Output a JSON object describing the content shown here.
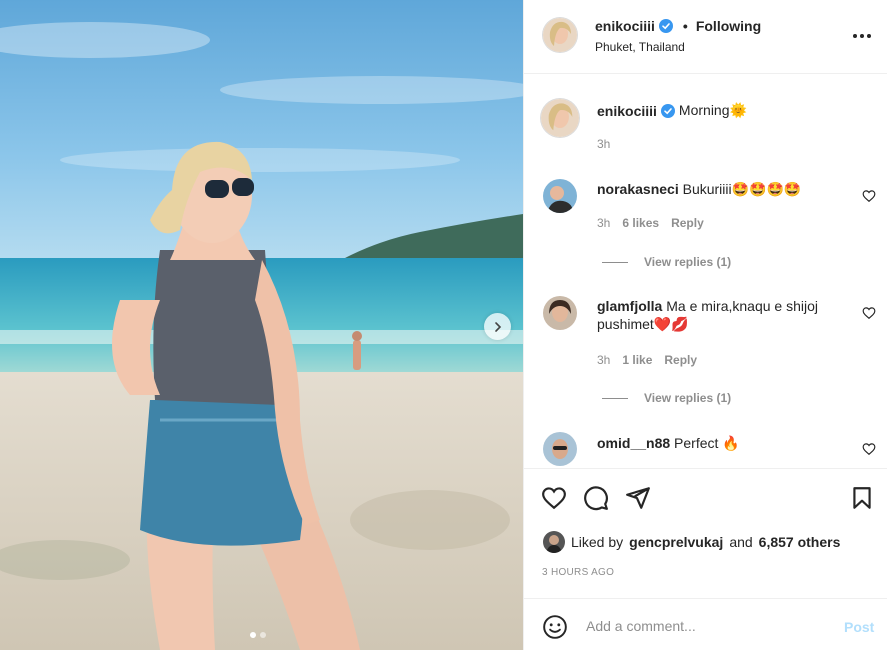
{
  "post": {
    "username": "enikociiii",
    "following_label": "Following",
    "location": "Phuket, Thailand",
    "caption": "Morning🌞",
    "caption_time": "3h"
  },
  "photo": {
    "slide_count": 2,
    "active_slide": 1,
    "next_icon": "chevron-right-icon"
  },
  "comments": [
    {
      "username": "norakasneci",
      "text": "Bukuriiii🤩🤩🤩🤩",
      "time": "3h",
      "likes": "6 likes",
      "reply_label": "Reply",
      "view_replies": "View replies (1)"
    },
    {
      "username": "glamfjolla",
      "text": "Ma e mira,knaqu e shijoj pushimet❤️💋",
      "time": "3h",
      "likes": "1 like",
      "reply_label": "Reply",
      "view_replies": "View replies (1)"
    },
    {
      "username": "omid__n88",
      "text": "Perfect 🔥"
    }
  ],
  "likes": {
    "prefix": "Liked by",
    "user": "gencprelvukaj",
    "middle": "and",
    "others": "6,857 others"
  },
  "timestamp": "3 HOURS AGO",
  "add_comment": {
    "placeholder": "Add a comment...",
    "post_label": "Post"
  },
  "colors": {
    "text": "#262626",
    "muted": "#8e8e8e",
    "verified": "#3897f0",
    "post_disabled": "#b2dffc",
    "border": "#efefef"
  },
  "icons": [
    "heart-icon",
    "comment-icon",
    "share-icon",
    "bookmark-icon",
    "more-icon",
    "emoji-icon",
    "verified-icon"
  ]
}
